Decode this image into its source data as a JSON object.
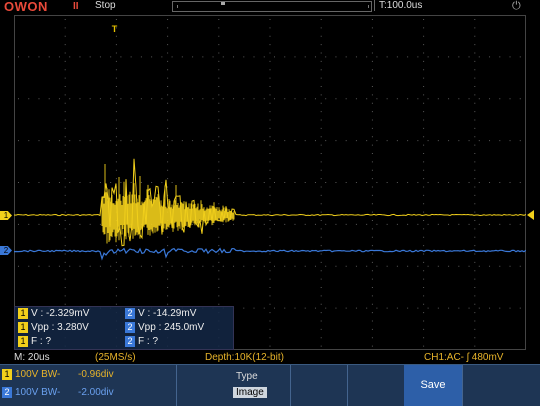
{
  "header": {
    "brand": "OWON",
    "run_icon": "II",
    "run_status": "Stop",
    "timebase": "T:100.0us",
    "power_icon": "power-icon"
  },
  "screen": {
    "trigger_marker": "T",
    "ch1_marker": "1",
    "ch2_marker": "2"
  },
  "measurements": {
    "rows": [
      {
        "ch_a": "1",
        "a": "V : -2.329mV",
        "ch_b": "2",
        "b": "V : -14.29mV"
      },
      {
        "ch_a": "1",
        "a": "Vpp : 3.280V",
        "ch_b": "2",
        "b": "Vpp : 245.0mV"
      },
      {
        "ch_a": "1",
        "a": "F : ?",
        "ch_b": "2",
        "b": "F : ?"
      }
    ]
  },
  "status": {
    "timebase": "M: 20us",
    "sample_rate": "(25MS/s)",
    "depth": "Depth:10K(12-bit)",
    "trigger": "CH1:AC- ʃ 480mV"
  },
  "menu": {
    "ch1": {
      "tag": "1",
      "scale": "100V BW-",
      "offset": "-0.96div"
    },
    "ch2": {
      "tag": "2",
      "scale": "100V BW-",
      "offset": "-2.00div"
    },
    "type_label": "Type",
    "type_value": "Image",
    "save_label": "Save"
  },
  "colors": {
    "ch1": "#f2d01b",
    "ch2": "#3a78d8",
    "brand": "#e94a3a",
    "menu_bg": "#1e3554",
    "save_bg": "#2d5fa8"
  }
}
